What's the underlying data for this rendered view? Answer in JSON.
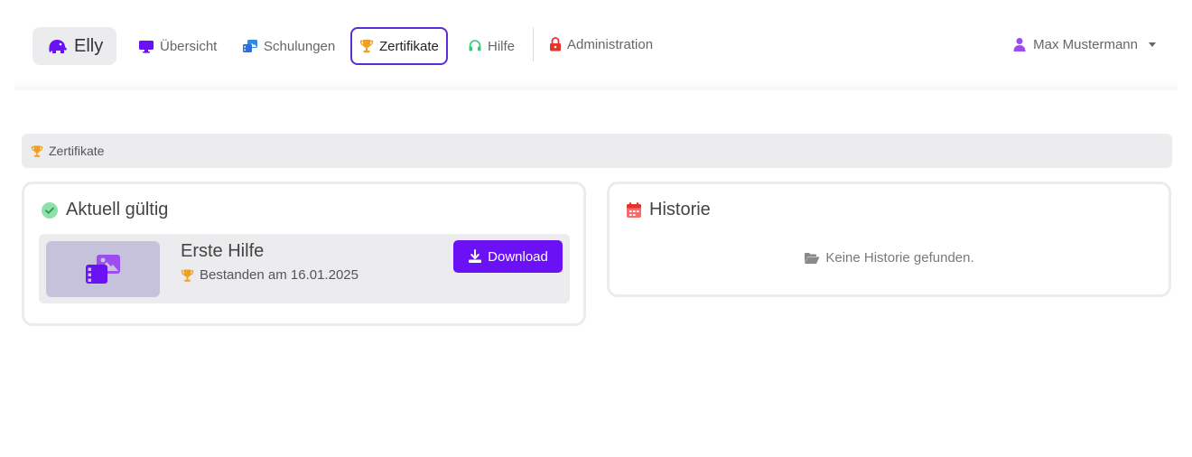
{
  "navbar": {
    "brand": {
      "name": "Elly",
      "icon": "elephant-icon"
    },
    "items": [
      {
        "label": "Übersicht",
        "icon": "monitor-icon"
      },
      {
        "label": "Schulungen",
        "icon": "photo-video-icon"
      },
      {
        "label": "Zertifikate",
        "icon": "trophy-icon",
        "active": true
      },
      {
        "label": "Hilfe",
        "icon": "headset-icon"
      },
      {
        "label": "Administration",
        "icon": "lock-icon"
      }
    ],
    "user": {
      "name": "Max Mustermann",
      "icon": "user-icon"
    }
  },
  "breadcrumb": {
    "label": "Zertifikate",
    "icon": "trophy-icon"
  },
  "current": {
    "title": "Aktuell gültig",
    "icon": "check-circle-icon",
    "certificates": [
      {
        "name": "Erste Hilfe",
        "status": "Bestanden am 16.01.2025",
        "thumbnail_icon": "photo-video-icon",
        "download_label": "Download"
      }
    ]
  },
  "history": {
    "title": "Historie",
    "icon": "calendar-icon",
    "empty_text": "Keine Historie gefunden.",
    "empty_icon": "folder-open-icon"
  },
  "colors": {
    "accent": "#6a11f5",
    "active_border": "#5b2fd6",
    "trophy": "#f0a020",
    "success": "#2ecc71",
    "danger": "#e8302d",
    "panel_bg": "#ececef"
  }
}
